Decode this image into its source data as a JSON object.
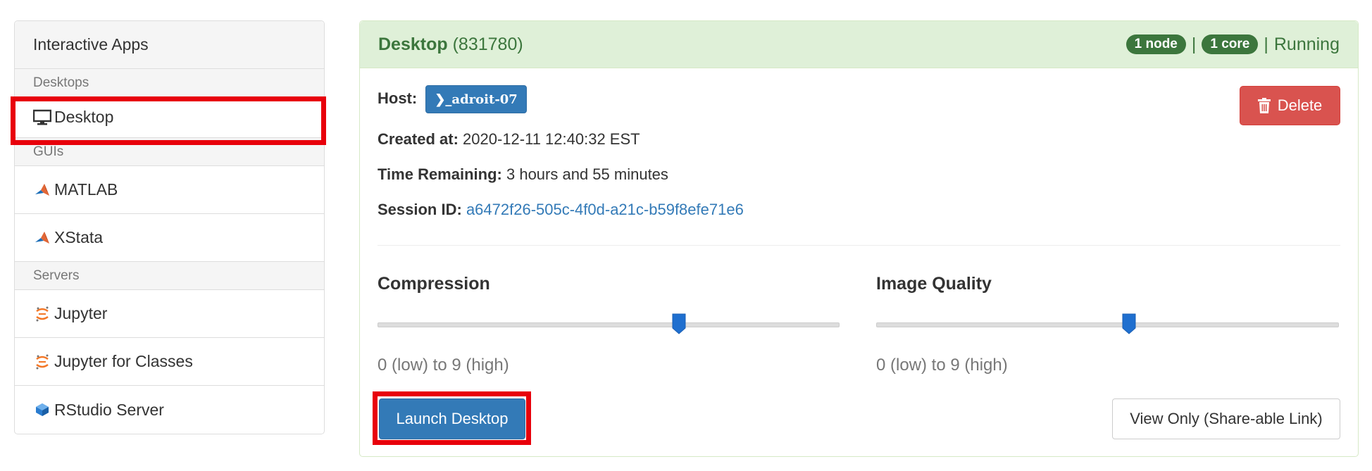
{
  "sidebar": {
    "header": "Interactive Apps",
    "sections": [
      {
        "label": "Desktops"
      },
      {
        "label": "GUIs"
      },
      {
        "label": "Servers"
      }
    ],
    "items": {
      "desktop": "Desktop",
      "matlab": "MATLAB",
      "xstata": "XStata",
      "jupyter": "Jupyter",
      "jupyter_classes": "Jupyter for Classes",
      "rstudio": "RStudio Server"
    }
  },
  "session": {
    "title": "Desktop",
    "id_display": "(831780)",
    "nodes": "1 node",
    "cores": "1 core",
    "separator": "|",
    "status": "Running",
    "host_label": "Host:",
    "host_value": "❯_adroit-07",
    "created_label": "Created at:",
    "created_value": "2020-12-11 12:40:32 EST",
    "time_label": "Time Remaining:",
    "time_value": "3 hours and 55 minutes",
    "session_label": "Session ID:",
    "session_value": "a6472f26-505c-4f0d-a21c-b59f8efe71e6",
    "delete_label": "Delete"
  },
  "controls": {
    "compression": {
      "label": "Compression",
      "hint": "0 (low) to 9 (high)",
      "value": 6,
      "min": 0,
      "max": 9
    },
    "image_quality": {
      "label": "Image Quality",
      "hint": "0 (low) to 9 (high)",
      "value": 5,
      "min": 0,
      "max": 9
    }
  },
  "actions": {
    "launch": "Launch Desktop",
    "view_only": "View Only (Share-able Link)"
  },
  "colors": {
    "highlight": "#e8000b",
    "primary": "#337ab7",
    "danger": "#d9534f",
    "success_bg": "#dff0d8",
    "success_text": "#3c763d"
  }
}
